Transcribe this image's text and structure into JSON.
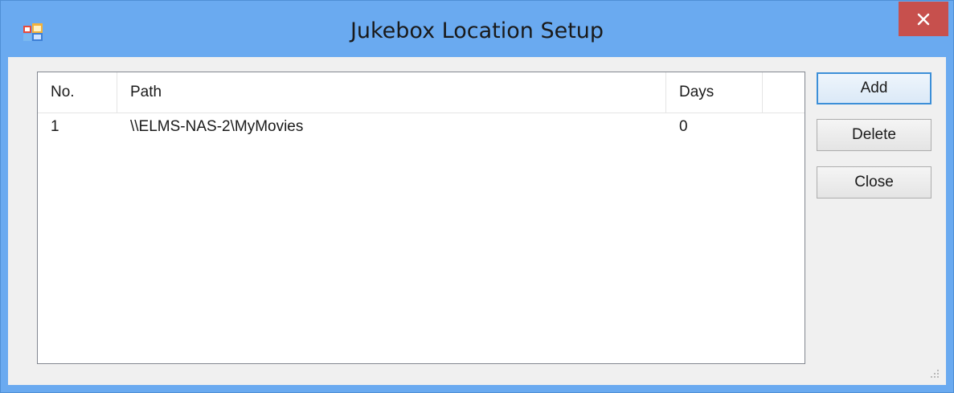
{
  "window": {
    "title": "Jukebox Location Setup",
    "app_icon": "windows-form-icon",
    "close_icon": "close-icon",
    "accent": "#6aaaf0",
    "close_color": "#c7504d"
  },
  "list": {
    "columns": [
      {
        "label": "No."
      },
      {
        "label": "Path"
      },
      {
        "label": "Days"
      },
      {
        "label": ""
      }
    ],
    "rows": [
      {
        "no": "1",
        "path": "\\\\ELMS-NAS-2\\MyMovies",
        "days": "0"
      }
    ]
  },
  "buttons": {
    "add": "Add",
    "delete": "Delete",
    "close": "Close"
  }
}
